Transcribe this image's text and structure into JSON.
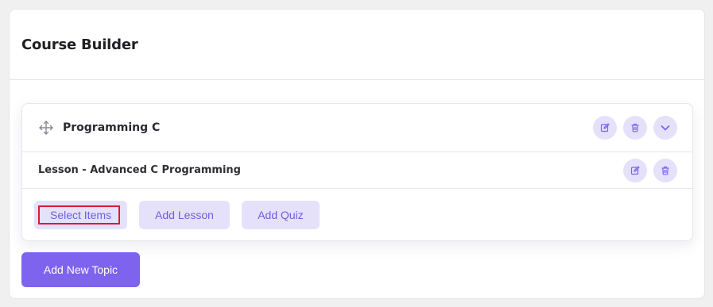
{
  "page": {
    "title": "Course Builder"
  },
  "topic": {
    "name": "Programming C",
    "lessons": [
      {
        "title": "Lesson - Advanced C Programming"
      }
    ],
    "buttons": {
      "select_items": "Select Items",
      "add_lesson": "Add Lesson",
      "add_quiz": "Add Quiz"
    }
  },
  "add_topic_label": "Add New Topic",
  "icons": {
    "move": "move-icon",
    "edit": "pencil-icon",
    "delete": "trash-icon",
    "expand": "chevron-down-icon"
  },
  "colors": {
    "accent": "#7d63ee",
    "accent_light": "#e6e1fa",
    "accent_text": "#6f5ddb",
    "highlight": "#e0192b"
  }
}
